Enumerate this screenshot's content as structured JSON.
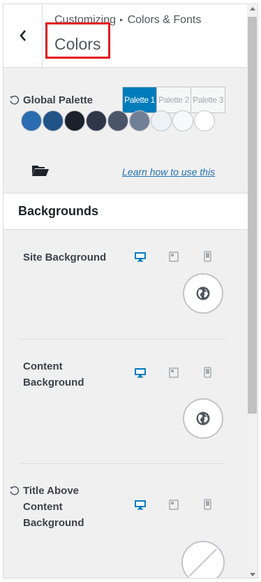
{
  "header": {
    "breadcrumb_root": "Customizing",
    "breadcrumb_separator": "▸",
    "breadcrumb_current": "Colors & Fonts",
    "title": "Colors"
  },
  "global_palette": {
    "label": "Global Palette",
    "tabs": [
      {
        "label": "Palette 1",
        "active": true
      },
      {
        "label": "Palette 2",
        "active": false
      },
      {
        "label": "Palette 3",
        "active": false
      }
    ],
    "swatches": [
      "#2b6cb0",
      "#215387",
      "#1a202c",
      "#2d3748",
      "#4a5568",
      "#718096",
      "#edf2f7",
      "#f7fafc",
      "#ffffff"
    ],
    "link": "Learn how to use this"
  },
  "backgrounds": {
    "section_title": "Backgrounds",
    "rows": [
      {
        "label": "Site Background",
        "control": "globe-icon"
      },
      {
        "label": "Content Background",
        "control": "globe-icon"
      },
      {
        "label": "Title Above Content Background",
        "control": "slash-none-icon"
      }
    ]
  },
  "colors": {
    "accent": "#007cba",
    "highlight_box": "#e3141b"
  }
}
